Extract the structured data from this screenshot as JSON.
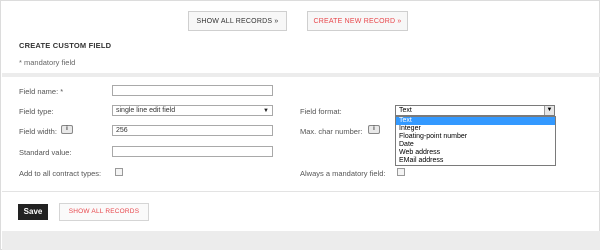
{
  "nav": {
    "show_all_records": "SHOW ALL RECORDS »",
    "create_new_record": "CREATE NEW RECORD »"
  },
  "page": {
    "title": "CREATE CUSTOM FIELD",
    "mandatory_note": "* mandatory field"
  },
  "form": {
    "field_name_label": "Field name: *",
    "field_name_value": "",
    "field_type_label": "Field type:",
    "field_type_value": "single line edit field",
    "field_width_label": "Field width:",
    "field_width_value": "256",
    "standard_value_label": "Standard value:",
    "standard_value_value": "",
    "add_to_all_label": "Add to all contract types:",
    "field_format_label": "Field format:",
    "field_format_value": "Text",
    "max_char_label": "Max. char number:",
    "always_mandatory_label": "Always a mandatory field:",
    "info_glyph": "i"
  },
  "format_options": [
    "Text",
    "Integer",
    "Floating-point number",
    "Date",
    "Web address",
    "EMail address"
  ],
  "actions": {
    "save": "Save",
    "show_all_records": "SHOW ALL RECORDS"
  },
  "colors": {
    "accent_red": "#e8474c",
    "selected_option": "#3399ff"
  }
}
